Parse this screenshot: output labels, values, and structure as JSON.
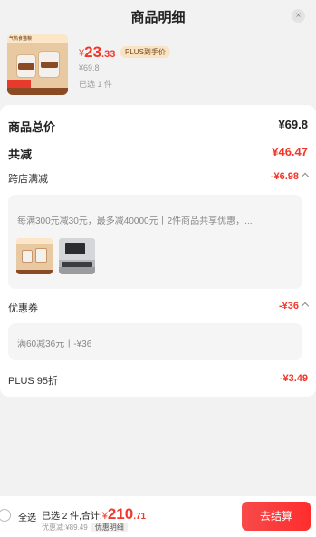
{
  "header": {
    "title": "商品明细",
    "close_icon": "×"
  },
  "product": {
    "thumb_strip_text": "气热食猫粮",
    "price_symbol": "¥",
    "price_integer": "23",
    "price_decimal": ".33",
    "plus_tag": "PLUS到手价",
    "original_price": "¥69.8",
    "quantity": "已选 1 件"
  },
  "summary_rows": {
    "total_label": "商品总价",
    "total_value": "¥69.8",
    "reduce_label": "共减",
    "reduce_value": "¥46.47",
    "cross_label": "跨店满减",
    "cross_value": "-¥6.98",
    "cross_desc": "每满300元减30元，最多减40000元丨2件商品共享优惠，...",
    "coupon_label": "优惠券",
    "coupon_value": "-¥36",
    "coupon_desc": "满60减36元丨-¥36",
    "plus_label": "PLUS 95折",
    "plus_value": "-¥3.49"
  },
  "footer": {
    "select_all": "全选",
    "summary_prefix": "已选 2 件,合计:",
    "sum_symbol": "¥",
    "sum_integer": "210",
    "sum_decimal": ".71",
    "sub_discount": "优惠减:¥89.49",
    "detail_tag": "优惠明细",
    "checkout": "去结算"
  },
  "colors": {
    "accent": "#f0372a",
    "plus_tag_bg": "#f9e3c4"
  }
}
